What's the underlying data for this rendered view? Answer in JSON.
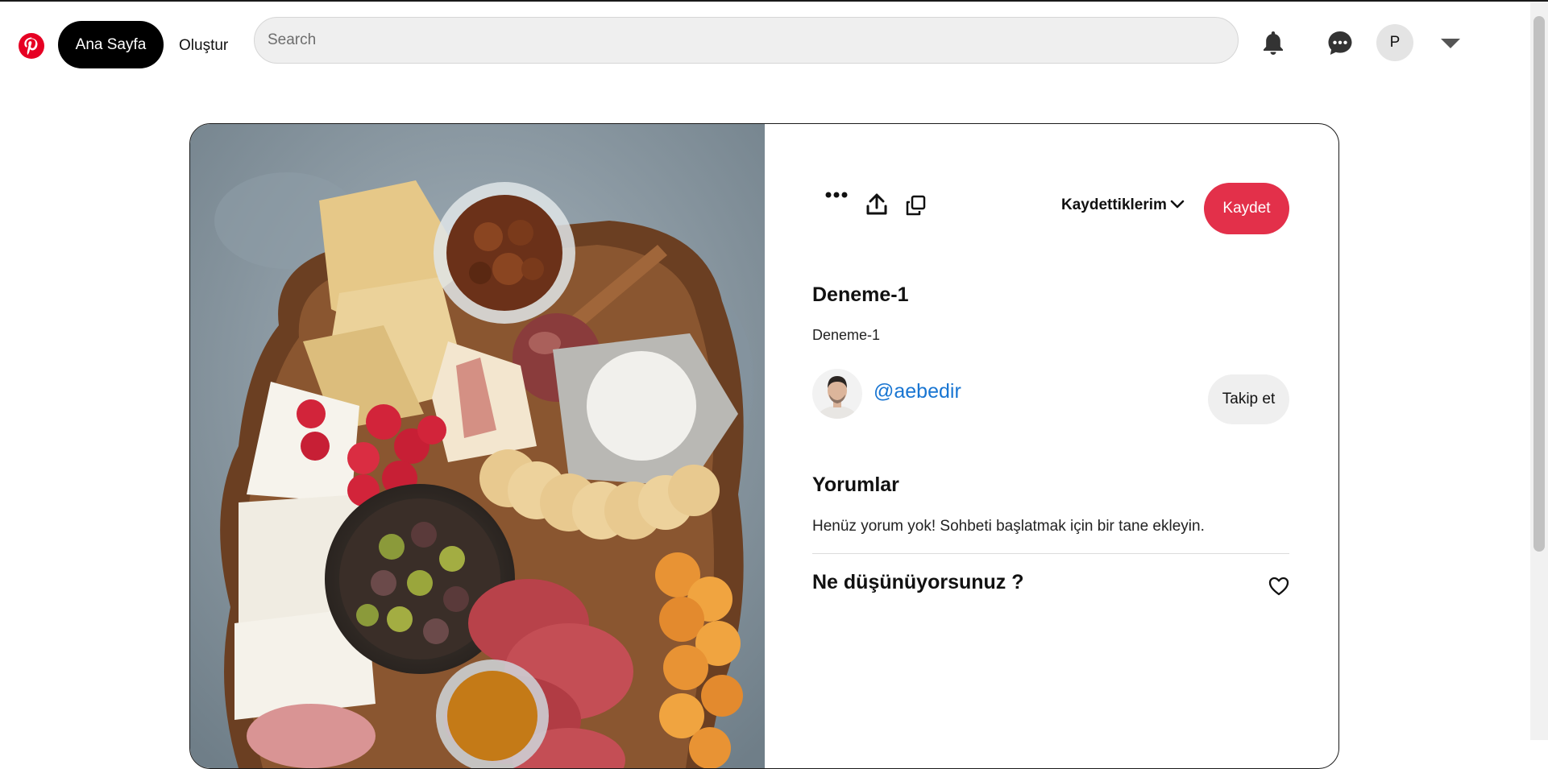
{
  "header": {
    "logo_icon": "pinterest-logo",
    "home_label": "Ana Sayfa",
    "create_label": "Oluştur",
    "search_placeholder": "Search",
    "notifications_icon": "bell-icon",
    "messages_icon": "chat-bubble-icon",
    "profile_initial": "P",
    "account_menu_icon": "chevron-down-icon"
  },
  "pin": {
    "image_icon": "charcuterie-board-photo",
    "actions": {
      "more_icon": "ellipsis-icon",
      "share_icon": "upload-icon",
      "copy_icon": "copy-icon"
    },
    "board_label": "Kaydettiklerim",
    "save_label": "Kaydet",
    "title": "Deneme-1",
    "description": "Deneme-1",
    "author": {
      "handle": "@aebedir",
      "follow_label": "Takip et"
    },
    "comments": {
      "title": "Yorumlar",
      "empty_text": "Henüz yorum yok! Sohbeti başlatmak için bir tane ekleyin.",
      "prompt": "Ne düşünüyorsunuz ?",
      "like_icon": "heart-icon"
    }
  },
  "colors": {
    "accent_red": "#e3304a",
    "link_blue": "#1875d2",
    "chip_gray": "#efefef"
  }
}
